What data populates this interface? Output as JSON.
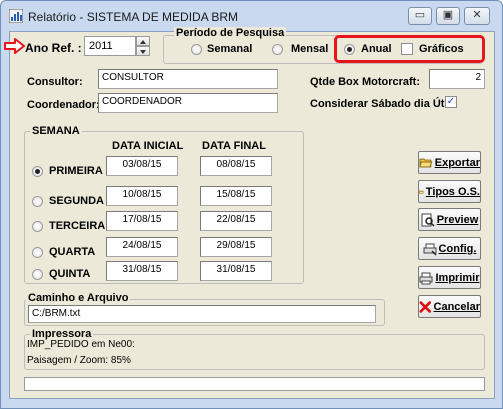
{
  "window": {
    "title": "Relatório - SISTEMA DE MEDIDA BRM",
    "minimize": "▭",
    "maximize": "▣",
    "close": "✕"
  },
  "ano_ref": {
    "label": "Ano Ref. :",
    "value": "2011"
  },
  "periodo": {
    "legend": "Período de Pesquisa",
    "options": [
      "Semanal",
      "Mensal",
      "Anual"
    ],
    "selected": "Anual",
    "graficos_label": "Gráficos",
    "graficos_checked": false
  },
  "consultor": {
    "label": "Consultor:",
    "value": "CONSULTOR"
  },
  "coordenador": {
    "label": "Coordenador:",
    "value": "COORDENADOR"
  },
  "qtde_box": {
    "label": "Qtde Box Motorcraft:",
    "value": "2"
  },
  "sabado": {
    "label": "Considerar Sábado dia Útil",
    "checked": true,
    "check_glyph": "✓"
  },
  "semana": {
    "legend": "SEMANA",
    "col_inicial": "DATA INICIAL",
    "col_final": "DATA FINAL",
    "rows": [
      {
        "label": "PRIMEIRA",
        "inicial": "03/08/15",
        "final": "08/08/15"
      },
      {
        "label": "SEGUNDA",
        "inicial": "10/08/15",
        "final": "15/08/15"
      },
      {
        "label": "TERCEIRA",
        "inicial": "17/08/15",
        "final": "22/08/15"
      },
      {
        "label": "QUARTA",
        "inicial": "24/08/15",
        "final": "29/08/15"
      },
      {
        "label": "QUINTA",
        "inicial": "31/08/15",
        "final": "31/08/15"
      }
    ]
  },
  "caminho": {
    "legend": "Caminho e Arquivo",
    "value": "C:/BRM.txt"
  },
  "impressora": {
    "legend": "Impressora",
    "line1": "IMP_PEDIDO em Ne00:",
    "line2": "Paisagem / Zoom: 85%"
  },
  "buttons": {
    "exportar": "Exportar",
    "tipos": "Tipos O.S.",
    "preview": "Preview",
    "config": "Config.",
    "imprimir": "Imprimir",
    "cancelar": "Cancelar"
  },
  "colors": {
    "highlight": "#e8141c",
    "arrow": "#e8141c",
    "check": "#1a3fbf"
  }
}
